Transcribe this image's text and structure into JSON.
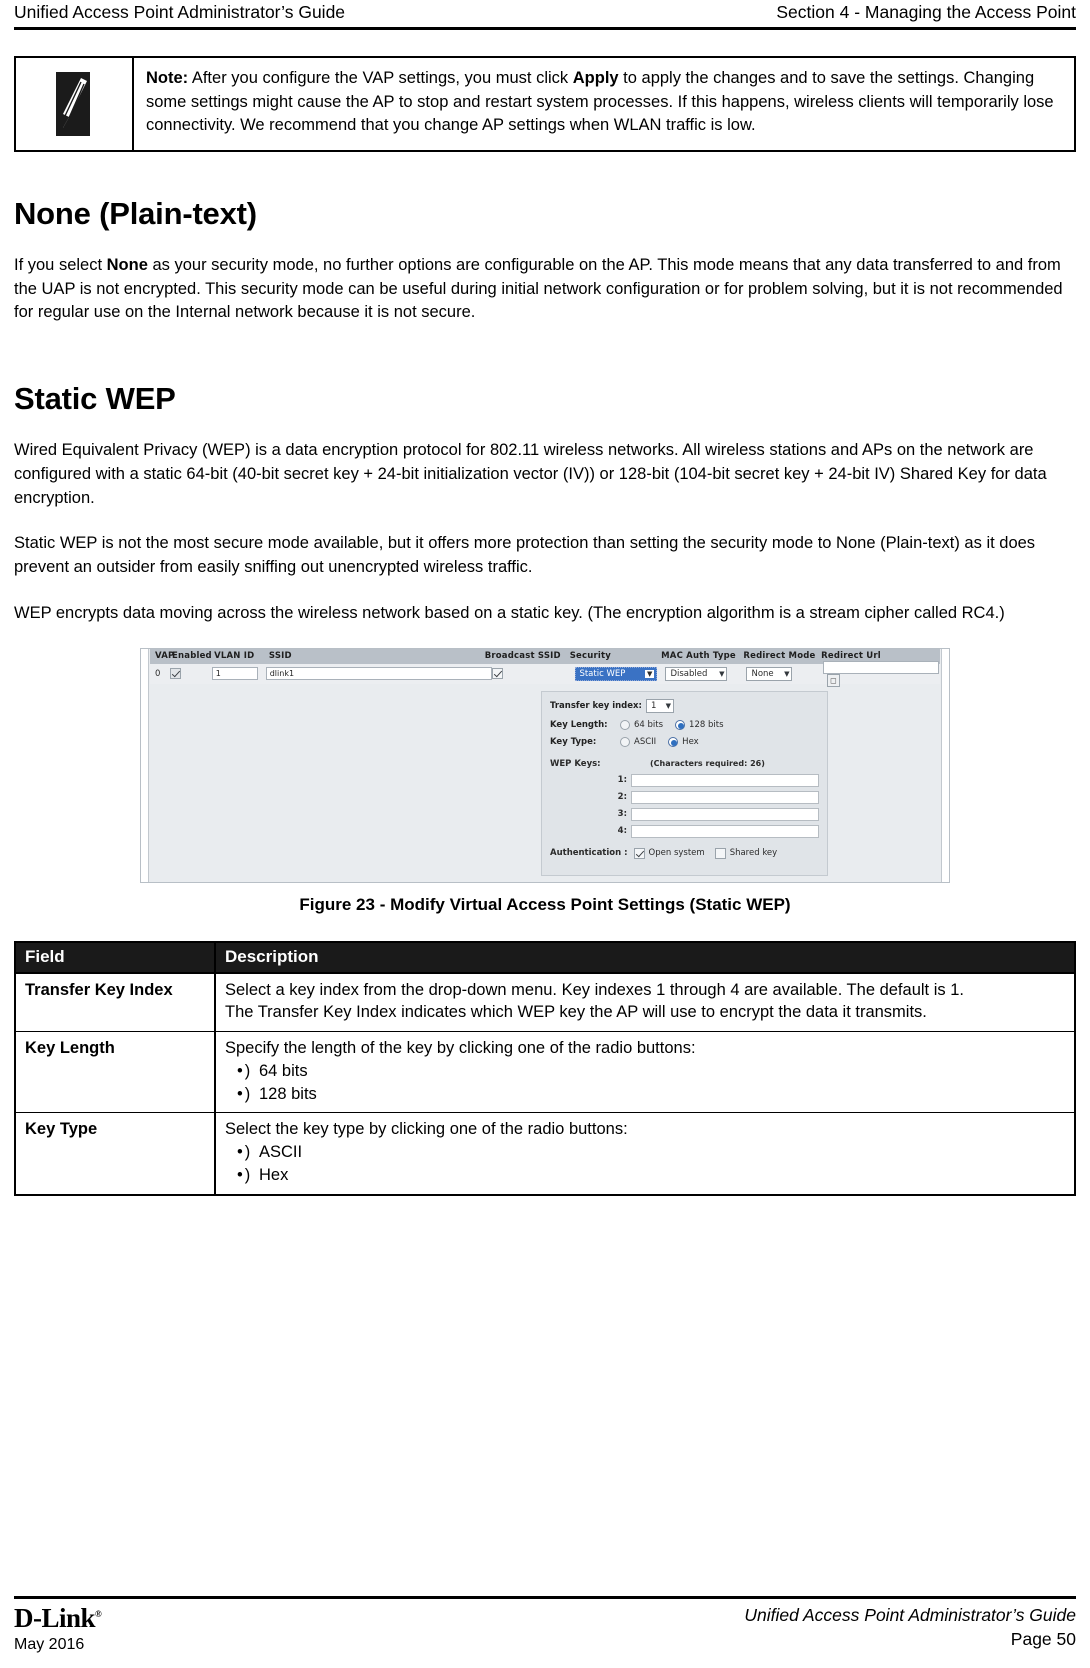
{
  "running_head": {
    "left": "Unified Access Point Administrator’s Guide",
    "right": "Section 4 - Managing the Access Point"
  },
  "note": {
    "icon": "pencil-note-icon",
    "label": "Note:",
    "text": " After you configure the VAP settings, you must click ",
    "bold_term": "Apply",
    "text_tail": " to apply the changes and to save the settings. Changing some settings might cause the AP to stop and restart system processes. If this happens, wireless clients will temporarily lose connectivity. We recommend that you change AP settings when WLAN traffic is low."
  },
  "sections": [
    {
      "heading": "None (Plain-text)",
      "paragraphs": [
        "If you select None as your security mode, no further options are configurable on the AP. This mode means that any data transferred to and from the UAP is not encrypted. This security mode can be useful during initial network configuration or for problem solving, but it is not recommended for regular use on the Internal network because it is not secure."
      ]
    },
    {
      "heading": "Static WEP",
      "paragraphs": [
        "Wired Equivalent Privacy (WEP) is a data encryption protocol for 802.11 wireless networks. All wireless stations and APs on the network are configured with a static 64-bit (40-bit secret key + 24-bit initialization vector (IV)) or 128-bit (104-bit secret key + 24-bit IV) Shared Key for data encryption.",
        "Static WEP is not the most secure mode available, but it offers more protection than setting the security mode to None (Plain-text) as it does prevent an outsider from easily sniffing out unencrypted wireless traffic.",
        "WEP encrypts data moving across the wireless network based on a static key. (The encryption algorithm is a stream cipher called RC4.)"
      ]
    }
  ],
  "none_paragraph": {
    "pre": "If you select ",
    "bold": "None",
    "post": " as your security mode, no further options are configurable on the AP. This mode means that any data transferred to and from the UAP is not encrypted. This security mode can be useful during initial network configuration or for problem solving, but it is not recommended for regular use on the Internal network because it is not secure."
  },
  "figure": {
    "caption": "Figure 23 - Modify Virtual Access Point Settings (Static WEP)",
    "vap_table": {
      "headers": {
        "vap": "VAP",
        "enabled": "Enabled",
        "vlan_id": "VLAN ID",
        "ssid": "SSID",
        "broadcast_ssid": "Broadcast SSID",
        "security": "Security",
        "mac_auth_type": "MAC Auth Type",
        "redirect_mode": "Redirect Mode",
        "redirect_url": "Redirect Url"
      },
      "row": {
        "vap": "0",
        "enabled_checked": "checked",
        "vlan_id": "1",
        "ssid": "dlink1",
        "broadcast_checked": "checked",
        "security": "Static WEP",
        "mac_auth_type": "Disabled",
        "redirect_mode": "None",
        "redirect_url": ""
      }
    },
    "wep_panel": {
      "transfer_key_index_label": "Transfer key index:",
      "transfer_key_index_value": "1",
      "key_length_label": "Key Length:",
      "key_length_options": [
        "64 bits",
        "128 bits"
      ],
      "key_length_selected": "128 bits",
      "key_type_label": "Key Type:",
      "key_type_options": [
        "ASCII",
        "Hex"
      ],
      "key_type_selected": "Hex",
      "wep_keys_label": "WEP Keys:",
      "characters_required": "(Characters required: 26)",
      "key_numbers": [
        "1:",
        "2:",
        "3:",
        "4:"
      ],
      "key_values": [
        "",
        "",
        "",
        ""
      ],
      "authentication_label": "Authentication :",
      "auth_open_system": "Open system",
      "auth_open_system_checked": "checked",
      "auth_shared_key": "Shared key",
      "auth_shared_key_checked": "unchecked"
    }
  },
  "fields_table": {
    "header": {
      "field": "Field",
      "description": "Description"
    },
    "rows": [
      {
        "field": "Transfer Key Index",
        "description_lines": [
          "Select a key index from the drop-down menu. Key indexes 1 through 4 are available. The default is 1.",
          "The Transfer Key Index indicates which WEP key the AP will use to encrypt the data it transmits."
        ],
        "bullets": []
      },
      {
        "field": "Key Length",
        "description_lines": [
          "Specify the length of the key by clicking one of the radio buttons:"
        ],
        "bullets": [
          "64 bits",
          "128 bits"
        ]
      },
      {
        "field": "Key Type",
        "description_lines": [
          "Select the key type by clicking one of the radio buttons:"
        ],
        "bullets": [
          "ASCII",
          "Hex"
        ]
      }
    ]
  },
  "footer": {
    "brand": "D-Link",
    "brand_mark": "®",
    "date": "May 2016",
    "guide": "Unified Access Point Administrator’s Guide",
    "page": "Page 50"
  }
}
